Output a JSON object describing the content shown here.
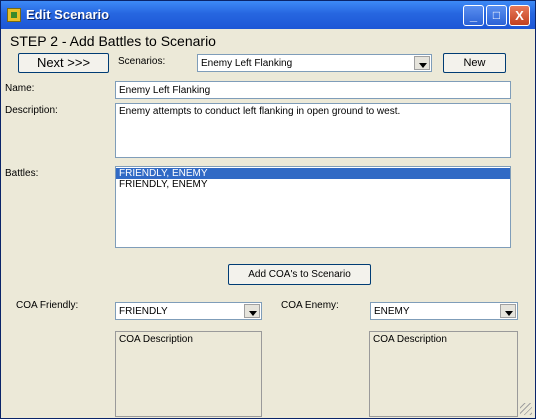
{
  "window": {
    "title": "Edit Scenario"
  },
  "title_buttons": {
    "minimize": "_",
    "maximize": "□",
    "close": "X"
  },
  "step_heading": "STEP 2 - Add Battles to Scenario",
  "next_button": "Next >>>",
  "scenarios": {
    "label": "Scenarios:",
    "selected": "Enemy Left Flanking",
    "new_button": "New"
  },
  "name": {
    "label": "Name:",
    "value": "Enemy Left Flanking"
  },
  "description": {
    "label": "Description:",
    "value": "Enemy attempts to conduct left flanking in open ground to west."
  },
  "battles": {
    "label": "Battles:",
    "items": [
      {
        "label": "FRIENDLY, ENEMY",
        "selected": true
      },
      {
        "label": "FRIENDLY, ENEMY",
        "selected": false
      }
    ]
  },
  "add_coa_button": "Add COA's to Scenario",
  "coa_friendly": {
    "label": "COA Friendly:",
    "selected": "FRIENDLY",
    "description": "COA Description"
  },
  "coa_enemy": {
    "label": "COA Enemy:",
    "selected": "ENEMY",
    "description": "COA Description"
  },
  "colors": {
    "title_blue": "#2666e0",
    "selection": "#316ac5",
    "window_bg": "#ece9d8"
  }
}
